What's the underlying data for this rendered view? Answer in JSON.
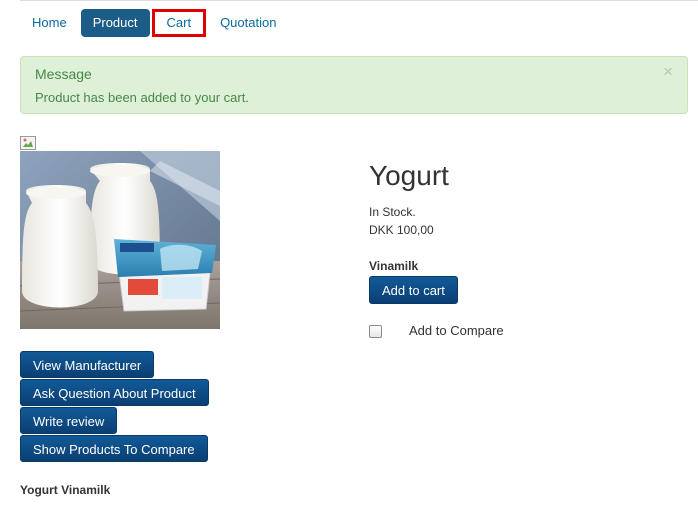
{
  "nav": {
    "items": [
      {
        "label": "Home"
      },
      {
        "label": "Product"
      },
      {
        "label": "Cart"
      },
      {
        "label": "Quotation"
      }
    ]
  },
  "message": {
    "title": "Message",
    "text": "Product has been added to your cart.",
    "close_glyph": "×"
  },
  "product": {
    "name": "Yogurt",
    "stock": "In Stock.",
    "price": "DKK 100,00",
    "manufacturer": "Vinamilk",
    "add_to_cart": "Add to cart",
    "compare_label": "Add to Compare",
    "image_caption": "Yogurt Vinamilk"
  },
  "actions": {
    "view_manufacturer": "View Manufacturer",
    "ask_question": "Ask Question About Product",
    "write_review": "Write review",
    "show_compare": "Show Products To Compare"
  }
}
